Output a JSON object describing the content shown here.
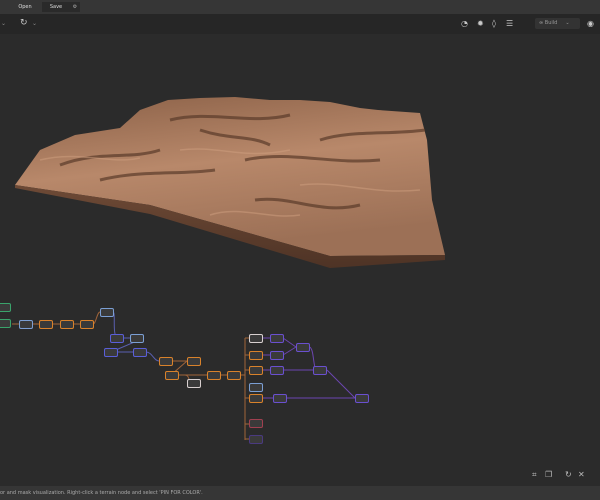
{
  "topbar": {
    "open_label": "Open",
    "save_label": "Save",
    "settings_icon": "gear-icon"
  },
  "toolbar": {
    "undo_icon": "chevron-down-icon",
    "refresh_icon": "refresh-icon",
    "build_label": "Build",
    "icons": [
      "gauge-icon",
      "sun-icon",
      "droplet-icon",
      "layers-icon",
      "target-icon"
    ]
  },
  "status": {
    "text": "or and mask visualization. Right-click a terrain node and select 'PIN FOR COLOR'."
  },
  "colors": {
    "orange": "#d9822b",
    "blue": "#7b9fd4",
    "purple": "#6a50d0",
    "green": "#3aa36b",
    "white": "#d8d0d0",
    "red": "#a04050",
    "terrain": "#a97b5e"
  }
}
